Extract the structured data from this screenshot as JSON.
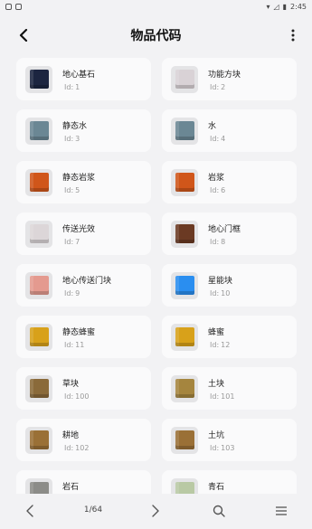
{
  "status": {
    "time": "2:45"
  },
  "header": {
    "title": "物品代码"
  },
  "id_prefix": "Id:",
  "items": [
    {
      "name": "地心基石",
      "id": "1",
      "color": "#1c2540",
      "icon": "bedrock-block"
    },
    {
      "name": "功能方块",
      "id": "2",
      "color": "#d9d2d6",
      "icon": "function-block"
    },
    {
      "name": "静态水",
      "id": "3",
      "color": "#6b8794",
      "icon": "water-block"
    },
    {
      "name": "水",
      "id": "4",
      "color": "#6b8794",
      "icon": "water-block"
    },
    {
      "name": "静态岩浆",
      "id": "5",
      "color": "#d0561a",
      "icon": "lava-block"
    },
    {
      "name": "岩浆",
      "id": "6",
      "color": "#d0561a",
      "icon": "lava-block"
    },
    {
      "name": "传送光效",
      "id": "7",
      "color": "#dcd6d8",
      "icon": "portal-effect-block"
    },
    {
      "name": "地心门框",
      "id": "8",
      "color": "#6b3a23",
      "icon": "portal-frame-block"
    },
    {
      "name": "地心传送门块",
      "id": "9",
      "color": "#e49a8f",
      "icon": "portal-block"
    },
    {
      "name": "星能块",
      "id": "10",
      "color": "#2a8ef0",
      "icon": "star-energy-block"
    },
    {
      "name": "静态蜂蜜",
      "id": "11",
      "color": "#d8a11a",
      "icon": "honey-block"
    },
    {
      "name": "蜂蜜",
      "id": "12",
      "color": "#d8a11a",
      "icon": "honey-block"
    },
    {
      "name": "草块",
      "id": "100",
      "color": "#8a6a3a",
      "icon": "grass-block"
    },
    {
      "name": "土块",
      "id": "101",
      "color": "#a5853e",
      "icon": "dirt-block"
    },
    {
      "name": "耕地",
      "id": "102",
      "color": "#9a7036",
      "icon": "farmland-block"
    },
    {
      "name": "土坑",
      "id": "103",
      "color": "#9a7036",
      "icon": "dirt-pit-block"
    },
    {
      "name": "岩石",
      "id": "",
      "color": "#8c8c88",
      "icon": "rock-block"
    },
    {
      "name": "青石",
      "id": "",
      "color": "#b9c9a4",
      "icon": "bluestone-block"
    }
  ],
  "pagination": {
    "label": "1/64"
  }
}
